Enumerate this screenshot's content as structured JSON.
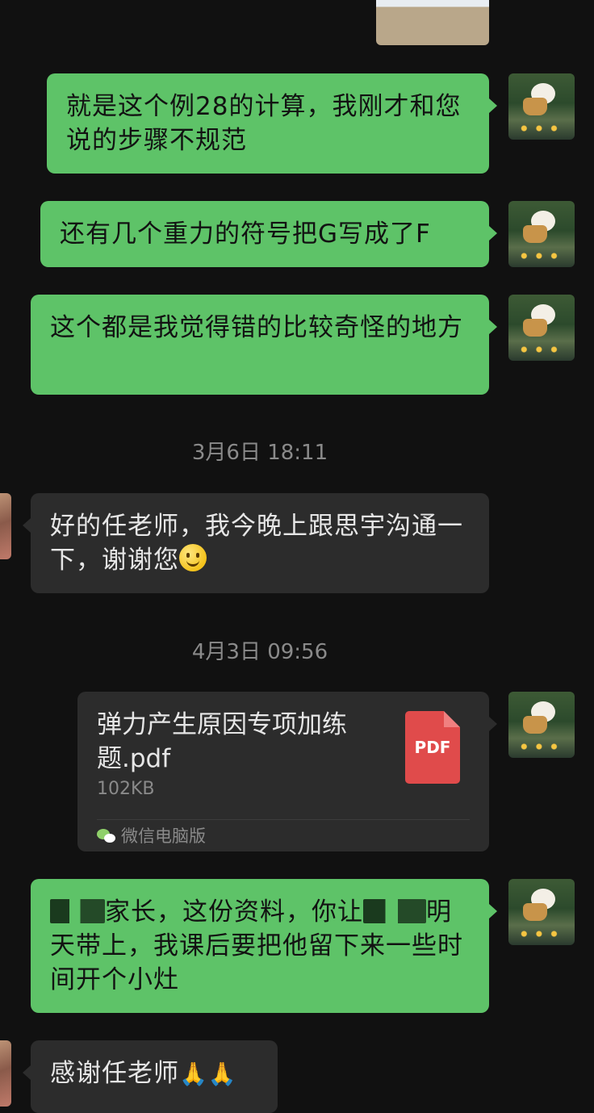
{
  "messages": [
    {
      "id": "m1",
      "text": "就是这个例28的计算，我刚才和您说的步骤不规范"
    },
    {
      "id": "m2",
      "text": "还有几个重力的符号把G写成了F"
    },
    {
      "id": "m3",
      "text": "这个都是我觉得错的比较奇怪的地方"
    },
    {
      "id": "m4",
      "text": "好的任老师，我今晚上跟思宇沟通一下，谢谢您"
    },
    {
      "id": "m6_part1",
      "text": "家长，这份资料，你让"
    },
    {
      "id": "m6_part2",
      "text": "明天带上，我课后要把他留下来一些时间开个小灶"
    },
    {
      "id": "m7",
      "text": "感谢任老师"
    }
  ],
  "timestamps": {
    "t1": "3月6日 18:11",
    "t2": "4月3日 09:56"
  },
  "file_message": {
    "file_name": "弹力产生原因专项加练题.pdf",
    "file_size": "102KB",
    "file_type_label": "PDF",
    "source_label": "微信电脑版"
  },
  "icons": {
    "smiley": "smiley-emoji-icon",
    "pray": "folded-hands-emoji-icon",
    "pdf": "pdf-file-icon",
    "wechat": "wechat-logo-icon"
  },
  "colors": {
    "background": "#111111",
    "my_bubble": "#5ec368",
    "their_bubble": "#2c2c2c",
    "timestamp_text": "#8a8a8a",
    "pdf_icon": "#e04b4b"
  }
}
